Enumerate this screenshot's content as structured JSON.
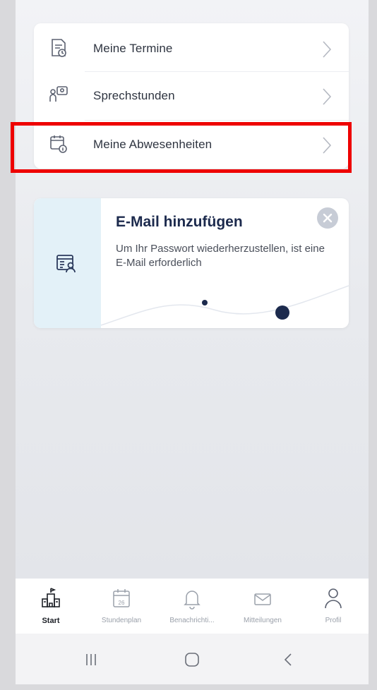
{
  "menu": {
    "items": [
      {
        "label": "Meine Termine",
        "icon": "appointments-icon"
      },
      {
        "label": "Sprechstunden",
        "icon": "consultation-icon"
      },
      {
        "label": "Meine Abwesenheiten",
        "icon": "absences-icon"
      }
    ]
  },
  "promo": {
    "title": "E-Mail hinzufügen",
    "text": "Um Ihr Passwort wiederherzustellen, ist eine E-Mail erforderlich",
    "icon": "contact-card-icon"
  },
  "tabbar": {
    "tabs": [
      {
        "label": "Start",
        "icon": "school-icon",
        "active": true
      },
      {
        "label": "Stundenplan",
        "icon": "calendar-icon",
        "date": "26",
        "active": false
      },
      {
        "label": "Benachrichti...",
        "icon": "bell-icon",
        "active": false
      },
      {
        "label": "Mitteilungen",
        "icon": "mail-icon",
        "active": false
      },
      {
        "label": "Profil",
        "icon": "profile-icon",
        "active": false
      }
    ]
  },
  "colors": {
    "highlight": "#ee0000",
    "accent_dark": "#1c2a4d",
    "promo_panel": "#e3f1f8"
  }
}
